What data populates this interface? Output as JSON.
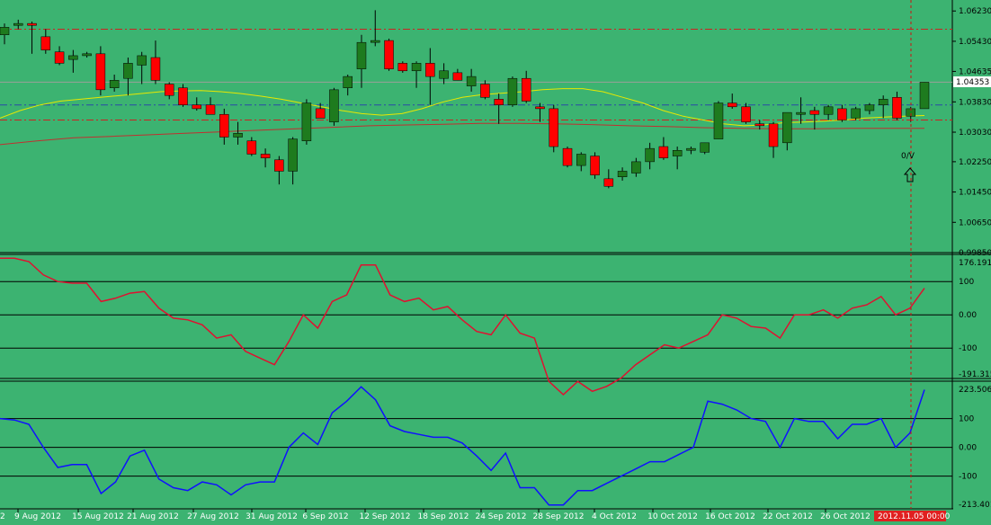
{
  "colors": {
    "background": "#3cb371",
    "bull_candle": "#1e7b1e",
    "bear_candle": "#ff0000",
    "wick": "#000000",
    "ma_fast": "#e8e800",
    "ma_slow": "#c03030",
    "level_line": "#cc2222",
    "mid_line": "#2a4aa8",
    "cci1_line": "#e01030",
    "cci2_line": "#1010ff",
    "current_price_bg": "#ffffff",
    "time_label_bg": "#e02020",
    "vline": "#d01010"
  },
  "current_price": "1.04353",
  "current_time": "2012.11.05 00:00",
  "annotation_text": "0/V",
  "annotation_icon": "up-arrow-outline",
  "price_axis_labels": [
    "1.06230",
    "1.05430",
    "1.04635",
    "1.03830",
    "1.03030",
    "1.02250",
    "1.01450",
    "1.00650",
    "0.99850"
  ],
  "date_labels": [
    "9 Aug 2012",
    "15 Aug 2012",
    "21 Aug 2012",
    "27 Aug 2012",
    "31 Aug 2012",
    "6 Sep 2012",
    "12 Sep 2012",
    "18 Sep 2012",
    "24 Sep 2012",
    "28 Sep 2012",
    "4 Oct 2012",
    "10 Oct 2012",
    "16 Oct 2012",
    "22 Oct 2012",
    "26 Oct 2012"
  ],
  "left_edge_label": "2",
  "cci1_labels": {
    "max": "176.1914",
    "upper": "100",
    "zero": "0.00",
    "lower": "-100",
    "min": "-191.315"
  },
  "cci2_labels": {
    "max": "223.5068",
    "upper": "100",
    "zero": "0.00",
    "lower": "-100",
    "min": "-213.401"
  },
  "chart_data": [
    {
      "type": "candlestick",
      "panel": "price",
      "x_labels": [
        "9 Aug 2012",
        "15 Aug 2012",
        "21 Aug 2012",
        "27 Aug 2012",
        "31 Aug 2012",
        "6 Sep 2012",
        "12 Sep 2012",
        "18 Sep 2012",
        "24 Sep 2012",
        "28 Sep 2012",
        "4 Oct 2012",
        "10 Oct 2012",
        "16 Oct 2012",
        "22 Oct 2012",
        "26 Oct 2012"
      ],
      "ylim": [
        0.9985,
        1.0652
      ],
      "candles": [
        {
          "o": 1.056,
          "h": 1.059,
          "l": 1.0535,
          "c": 1.058
        },
        {
          "o": 1.0585,
          "h": 1.06,
          "l": 1.0575,
          "c": 1.059
        },
        {
          "o": 1.059,
          "h": 1.0595,
          "l": 1.051,
          "c": 1.0585
        },
        {
          "o": 1.0555,
          "h": 1.0575,
          "l": 1.051,
          "c": 1.052
        },
        {
          "o": 1.0515,
          "h": 1.053,
          "l": 1.048,
          "c": 1.0485
        },
        {
          "o": 1.0495,
          "h": 1.052,
          "l": 1.046,
          "c": 1.0505
        },
        {
          "o": 1.0505,
          "h": 1.0515,
          "l": 1.05,
          "c": 1.051
        },
        {
          "o": 1.051,
          "h": 1.053,
          "l": 1.04,
          "c": 1.0415
        },
        {
          "o": 1.042,
          "h": 1.0455,
          "l": 1.041,
          "c": 1.044
        },
        {
          "o": 1.0445,
          "h": 1.05,
          "l": 1.04,
          "c": 1.0485
        },
        {
          "o": 1.048,
          "h": 1.0515,
          "l": 1.043,
          "c": 1.0505
        },
        {
          "o": 1.05,
          "h": 1.0545,
          "l": 1.043,
          "c": 1.044
        },
        {
          "o": 1.043,
          "h": 1.0435,
          "l": 1.039,
          "c": 1.04
        },
        {
          "o": 1.042,
          "h": 1.043,
          "l": 1.037,
          "c": 1.0375
        },
        {
          "o": 1.0375,
          "h": 1.0395,
          "l": 1.036,
          "c": 1.0365
        },
        {
          "o": 1.0375,
          "h": 1.0395,
          "l": 1.035,
          "c": 1.035
        },
        {
          "o": 1.035,
          "h": 1.0365,
          "l": 1.027,
          "c": 1.029
        },
        {
          "o": 1.029,
          "h": 1.033,
          "l": 1.027,
          "c": 1.03
        },
        {
          "o": 1.028,
          "h": 1.029,
          "l": 1.024,
          "c": 1.0245
        },
        {
          "o": 1.0245,
          "h": 1.026,
          "l": 1.021,
          "c": 1.0235
        },
        {
          "o": 1.023,
          "h": 1.024,
          "l": 1.0165,
          "c": 1.02
        },
        {
          "o": 1.02,
          "h": 1.029,
          "l": 1.0165,
          "c": 1.0285
        },
        {
          "o": 1.028,
          "h": 1.039,
          "l": 1.027,
          "c": 1.038
        },
        {
          "o": 1.0365,
          "h": 1.038,
          "l": 1.034,
          "c": 1.034
        },
        {
          "o": 1.033,
          "h": 1.042,
          "l": 1.032,
          "c": 1.0415
        },
        {
          "o": 1.042,
          "h": 1.0455,
          "l": 1.04,
          "c": 1.045
        },
        {
          "o": 1.047,
          "h": 1.056,
          "l": 1.042,
          "c": 1.054
        },
        {
          "o": 1.054,
          "h": 1.0625,
          "l": 1.053,
          "c": 1.0545
        },
        {
          "o": 1.0545,
          "h": 1.055,
          "l": 1.0465,
          "c": 1.047
        },
        {
          "o": 1.0485,
          "h": 1.049,
          "l": 1.046,
          "c": 1.0465
        },
        {
          "o": 1.0465,
          "h": 1.049,
          "l": 1.042,
          "c": 1.0485
        },
        {
          "o": 1.0485,
          "h": 1.0525,
          "l": 1.0375,
          "c": 1.045
        },
        {
          "o": 1.0445,
          "h": 1.0485,
          "l": 1.043,
          "c": 1.0465
        },
        {
          "o": 1.046,
          "h": 1.047,
          "l": 1.044,
          "c": 1.044
        },
        {
          "o": 1.0425,
          "h": 1.047,
          "l": 1.041,
          "c": 1.045
        },
        {
          "o": 1.043,
          "h": 1.044,
          "l": 1.039,
          "c": 1.0395
        },
        {
          "o": 1.039,
          "h": 1.0405,
          "l": 1.0325,
          "c": 1.0375
        },
        {
          "o": 1.0375,
          "h": 1.045,
          "l": 1.037,
          "c": 1.0445
        },
        {
          "o": 1.0445,
          "h": 1.0465,
          "l": 1.038,
          "c": 1.0385
        },
        {
          "o": 1.037,
          "h": 1.038,
          "l": 1.033,
          "c": 1.0365
        },
        {
          "o": 1.0365,
          "h": 1.0375,
          "l": 1.025,
          "c": 1.0265
        },
        {
          "o": 1.026,
          "h": 1.0265,
          "l": 1.021,
          "c": 1.0215
        },
        {
          "o": 1.0215,
          "h": 1.025,
          "l": 1.02,
          "c": 1.0245
        },
        {
          "o": 1.024,
          "h": 1.025,
          "l": 1.018,
          "c": 1.019
        },
        {
          "o": 1.018,
          "h": 1.0205,
          "l": 1.0155,
          "c": 1.016
        },
        {
          "o": 1.0185,
          "h": 1.021,
          "l": 1.0175,
          "c": 1.02
        },
        {
          "o": 1.0195,
          "h": 1.0235,
          "l": 1.0185,
          "c": 1.0225
        },
        {
          "o": 1.0225,
          "h": 1.0275,
          "l": 1.0205,
          "c": 1.026
        },
        {
          "o": 1.0265,
          "h": 1.029,
          "l": 1.023,
          "c": 1.0235
        },
        {
          "o": 1.024,
          "h": 1.0265,
          "l": 1.0205,
          "c": 1.0255
        },
        {
          "o": 1.0255,
          "h": 1.0265,
          "l": 1.0245,
          "c": 1.026
        },
        {
          "o": 1.025,
          "h": 1.0275,
          "l": 1.0245,
          "c": 1.0275
        },
        {
          "o": 1.0285,
          "h": 1.0385,
          "l": 1.0285,
          "c": 1.038
        },
        {
          "o": 1.038,
          "h": 1.0405,
          "l": 1.0365,
          "c": 1.037
        },
        {
          "o": 1.037,
          "h": 1.038,
          "l": 1.0325,
          "c": 1.033
        },
        {
          "o": 1.0325,
          "h": 1.0335,
          "l": 1.031,
          "c": 1.032
        },
        {
          "o": 1.0325,
          "h": 1.033,
          "l": 1.0235,
          "c": 1.0265
        },
        {
          "o": 1.0275,
          "h": 1.035,
          "l": 1.0255,
          "c": 1.0355
        },
        {
          "o": 1.035,
          "h": 1.0395,
          "l": 1.0325,
          "c": 1.0355
        },
        {
          "o": 1.036,
          "h": 1.037,
          "l": 1.031,
          "c": 1.035
        },
        {
          "o": 1.035,
          "h": 1.0375,
          "l": 1.0335,
          "c": 1.037
        },
        {
          "o": 1.0365,
          "h": 1.0375,
          "l": 1.033,
          "c": 1.0335
        },
        {
          "o": 1.034,
          "h": 1.037,
          "l": 1.0335,
          "c": 1.0365
        },
        {
          "o": 1.036,
          "h": 1.038,
          "l": 1.035,
          "c": 1.0375
        },
        {
          "o": 1.0375,
          "h": 1.04,
          "l": 1.034,
          "c": 1.039
        },
        {
          "o": 1.0395,
          "h": 1.041,
          "l": 1.0335,
          "c": 1.034
        },
        {
          "o": 1.0345,
          "h": 1.037,
          "l": 1.033,
          "c": 1.0365
        },
        {
          "o": 1.0365,
          "h": 1.0435,
          "l": 1.0365,
          "c": 1.0435
        }
      ],
      "ma_fast": [
        1.034,
        1.036,
        1.0375,
        1.0385,
        1.039,
        1.0395,
        1.04,
        1.0405,
        1.041,
        1.0412,
        1.0413,
        1.041,
        1.0405,
        1.0398,
        1.039,
        1.038,
        1.037,
        1.036,
        1.0352,
        1.0348,
        1.0352,
        1.0365,
        1.0382,
        1.0395,
        1.0402,
        1.0406,
        1.041,
        1.0415,
        1.0418,
        1.0418,
        1.041,
        1.0395,
        1.038,
        1.036,
        1.0345,
        1.0335,
        1.0325,
        1.032,
        1.0322,
        1.0328,
        1.033,
        1.0332,
        1.0335,
        1.034,
        1.0343,
        1.0345,
        1.0347
      ],
      "ma_slow": [
        1.027,
        1.028,
        1.0288,
        1.0292,
        1.0296,
        1.03,
        1.0304,
        1.0308,
        1.0312,
        1.0316,
        1.032,
        1.0322,
        1.0324,
        1.0326,
        1.0326,
        1.0325,
        1.0323,
        1.032,
        1.0318,
        1.0315,
        1.0313,
        1.0312,
        1.0312,
        1.0313,
        1.0313,
        1.0313
      ],
      "levels": {
        "upper": 1.0575,
        "mid": 1.0375,
        "lower": 1.0335
      }
    },
    {
      "type": "line",
      "panel": "cci_1",
      "series": [
        {
          "values": [
            170,
            170,
            160,
            120,
            100,
            95,
            95,
            40,
            50,
            65,
            70,
            20,
            -10,
            -15,
            -30,
            -70,
            -60,
            -110,
            -130,
            -150,
            -80,
            0,
            -40,
            40,
            60,
            150,
            150,
            60,
            40,
            50,
            15,
            25,
            -15,
            -50,
            -60,
            0,
            -55,
            -70,
            -200,
            -240,
            -200,
            -230,
            -215,
            -190,
            -150,
            -120,
            -90,
            -100,
            -80,
            -60,
            0,
            -10,
            -35,
            -40,
            -70,
            0,
            0,
            15,
            -10,
            20,
            30,
            55,
            0,
            20,
            80
          ]
        }
      ],
      "ylim": [
        -191.315,
        176.1914
      ],
      "reference_lines": [
        100,
        0,
        -100
      ]
    },
    {
      "type": "line",
      "panel": "cci_2",
      "series": [
        {
          "values": [
            100,
            95,
            80,
            0,
            -70,
            -60,
            -60,
            -160,
            -120,
            -30,
            -10,
            -110,
            -140,
            -150,
            -120,
            -130,
            -165,
            -130,
            -120,
            -120,
            0,
            50,
            10,
            120,
            160,
            210,
            165,
            75,
            55,
            45,
            35,
            35,
            15,
            -30,
            -80,
            -20,
            -140,
            -140,
            -200,
            -200,
            -150,
            -150,
            -125,
            -100,
            -75,
            -50,
            -50,
            -25,
            0,
            160,
            150,
            130,
            100,
            90,
            0,
            100,
            90,
            90,
            30,
            80,
            80,
            100,
            0,
            50,
            200
          ]
        }
      ],
      "ylim": [
        -213.401,
        223.5068
      ],
      "reference_lines": [
        100,
        0,
        -100
      ]
    }
  ]
}
